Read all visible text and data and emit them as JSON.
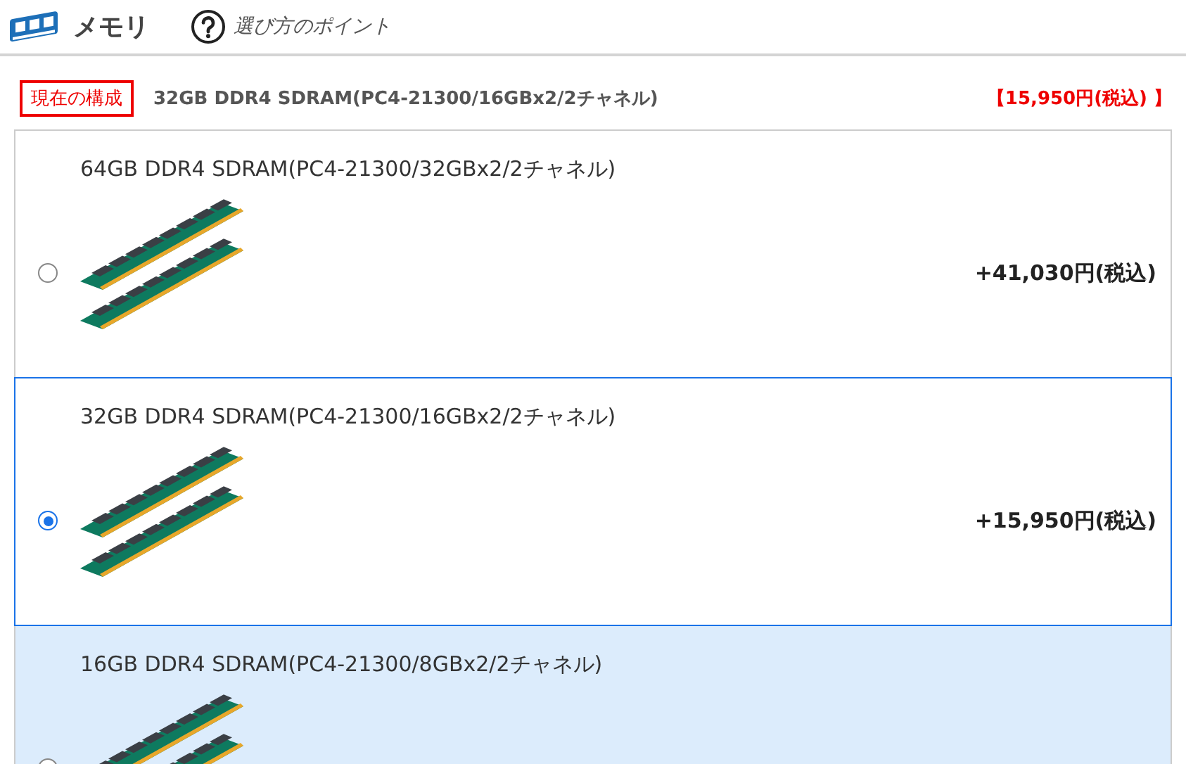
{
  "header": {
    "title": "メモリ",
    "help_link": "選び方のポイント"
  },
  "current": {
    "badge": "現在の構成",
    "name": "32GB DDR4 SDRAM(PC4-21300/16GBx2/2チャネル)",
    "price": "【15,950円(税込) 】"
  },
  "options": [
    {
      "name": "64GB DDR4 SDRAM(PC4-21300/32GBx2/2チャネル)",
      "price": "+41,030円(税込)",
      "selected": false,
      "highlighted": false
    },
    {
      "name": "32GB DDR4 SDRAM(PC4-21300/16GBx2/2チャネル)",
      "price": "+15,950円(税込)",
      "selected": true,
      "highlighted": false
    },
    {
      "name": "16GB DDR4 SDRAM(PC4-21300/8GBx2/2チャネル)",
      "selected": false,
      "highlighted": true
    }
  ]
}
